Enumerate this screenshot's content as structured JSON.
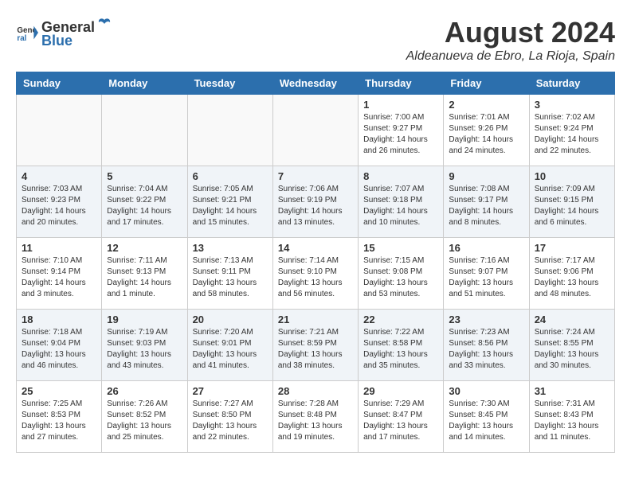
{
  "header": {
    "logo_general": "General",
    "logo_blue": "Blue",
    "month_title": "August 2024",
    "subtitle": "Aldeanueva de Ebro, La Rioja, Spain"
  },
  "weekdays": [
    "Sunday",
    "Monday",
    "Tuesday",
    "Wednesday",
    "Thursday",
    "Friday",
    "Saturday"
  ],
  "weeks": [
    [
      {
        "day": "",
        "info": ""
      },
      {
        "day": "",
        "info": ""
      },
      {
        "day": "",
        "info": ""
      },
      {
        "day": "",
        "info": ""
      },
      {
        "day": "1",
        "info": "Sunrise: 7:00 AM\nSunset: 9:27 PM\nDaylight: 14 hours\nand 26 minutes."
      },
      {
        "day": "2",
        "info": "Sunrise: 7:01 AM\nSunset: 9:26 PM\nDaylight: 14 hours\nand 24 minutes."
      },
      {
        "day": "3",
        "info": "Sunrise: 7:02 AM\nSunset: 9:24 PM\nDaylight: 14 hours\nand 22 minutes."
      }
    ],
    [
      {
        "day": "4",
        "info": "Sunrise: 7:03 AM\nSunset: 9:23 PM\nDaylight: 14 hours\nand 20 minutes."
      },
      {
        "day": "5",
        "info": "Sunrise: 7:04 AM\nSunset: 9:22 PM\nDaylight: 14 hours\nand 17 minutes."
      },
      {
        "day": "6",
        "info": "Sunrise: 7:05 AM\nSunset: 9:21 PM\nDaylight: 14 hours\nand 15 minutes."
      },
      {
        "day": "7",
        "info": "Sunrise: 7:06 AM\nSunset: 9:19 PM\nDaylight: 14 hours\nand 13 minutes."
      },
      {
        "day": "8",
        "info": "Sunrise: 7:07 AM\nSunset: 9:18 PM\nDaylight: 14 hours\nand 10 minutes."
      },
      {
        "day": "9",
        "info": "Sunrise: 7:08 AM\nSunset: 9:17 PM\nDaylight: 14 hours\nand 8 minutes."
      },
      {
        "day": "10",
        "info": "Sunrise: 7:09 AM\nSunset: 9:15 PM\nDaylight: 14 hours\nand 6 minutes."
      }
    ],
    [
      {
        "day": "11",
        "info": "Sunrise: 7:10 AM\nSunset: 9:14 PM\nDaylight: 14 hours\nand 3 minutes."
      },
      {
        "day": "12",
        "info": "Sunrise: 7:11 AM\nSunset: 9:13 PM\nDaylight: 14 hours\nand 1 minute."
      },
      {
        "day": "13",
        "info": "Sunrise: 7:13 AM\nSunset: 9:11 PM\nDaylight: 13 hours\nand 58 minutes."
      },
      {
        "day": "14",
        "info": "Sunrise: 7:14 AM\nSunset: 9:10 PM\nDaylight: 13 hours\nand 56 minutes."
      },
      {
        "day": "15",
        "info": "Sunrise: 7:15 AM\nSunset: 9:08 PM\nDaylight: 13 hours\nand 53 minutes."
      },
      {
        "day": "16",
        "info": "Sunrise: 7:16 AM\nSunset: 9:07 PM\nDaylight: 13 hours\nand 51 minutes."
      },
      {
        "day": "17",
        "info": "Sunrise: 7:17 AM\nSunset: 9:06 PM\nDaylight: 13 hours\nand 48 minutes."
      }
    ],
    [
      {
        "day": "18",
        "info": "Sunrise: 7:18 AM\nSunset: 9:04 PM\nDaylight: 13 hours\nand 46 minutes."
      },
      {
        "day": "19",
        "info": "Sunrise: 7:19 AM\nSunset: 9:03 PM\nDaylight: 13 hours\nand 43 minutes."
      },
      {
        "day": "20",
        "info": "Sunrise: 7:20 AM\nSunset: 9:01 PM\nDaylight: 13 hours\nand 41 minutes."
      },
      {
        "day": "21",
        "info": "Sunrise: 7:21 AM\nSunset: 8:59 PM\nDaylight: 13 hours\nand 38 minutes."
      },
      {
        "day": "22",
        "info": "Sunrise: 7:22 AM\nSunset: 8:58 PM\nDaylight: 13 hours\nand 35 minutes."
      },
      {
        "day": "23",
        "info": "Sunrise: 7:23 AM\nSunset: 8:56 PM\nDaylight: 13 hours\nand 33 minutes."
      },
      {
        "day": "24",
        "info": "Sunrise: 7:24 AM\nSunset: 8:55 PM\nDaylight: 13 hours\nand 30 minutes."
      }
    ],
    [
      {
        "day": "25",
        "info": "Sunrise: 7:25 AM\nSunset: 8:53 PM\nDaylight: 13 hours\nand 27 minutes."
      },
      {
        "day": "26",
        "info": "Sunrise: 7:26 AM\nSunset: 8:52 PM\nDaylight: 13 hours\nand 25 minutes."
      },
      {
        "day": "27",
        "info": "Sunrise: 7:27 AM\nSunset: 8:50 PM\nDaylight: 13 hours\nand 22 minutes."
      },
      {
        "day": "28",
        "info": "Sunrise: 7:28 AM\nSunset: 8:48 PM\nDaylight: 13 hours\nand 19 minutes."
      },
      {
        "day": "29",
        "info": "Sunrise: 7:29 AM\nSunset: 8:47 PM\nDaylight: 13 hours\nand 17 minutes."
      },
      {
        "day": "30",
        "info": "Sunrise: 7:30 AM\nSunset: 8:45 PM\nDaylight: 13 hours\nand 14 minutes."
      },
      {
        "day": "31",
        "info": "Sunrise: 7:31 AM\nSunset: 8:43 PM\nDaylight: 13 hours\nand 11 minutes."
      }
    ]
  ]
}
